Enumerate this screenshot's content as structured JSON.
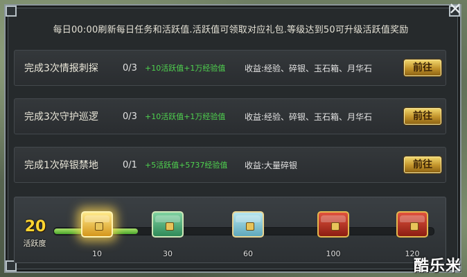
{
  "notice": "每日00:00刷新每日任务和活跃值.活跃值可领取对应礼包.等级达到50可升级活跃值奖励",
  "close_icon": "✕",
  "tasks": [
    {
      "name": "完成3次情报刺探",
      "count": "0/3",
      "reward": "+10活跃值+1万经验值",
      "gain": "收益:经验、碎银、玉石箱、月华石",
      "button": "前往"
    },
    {
      "name": "完成3次守护巡逻",
      "count": "0/3",
      "reward": "+10活跃值+1万经验值",
      "gain": "收益:经验、碎银、玉石箱、月华石",
      "button": "前往"
    },
    {
      "name": "完成1次碎银禁地",
      "count": "0/1",
      "reward": "+5活跃值+5737经验值",
      "gain": "收益:大量碎银",
      "button": "前往"
    }
  ],
  "activity": {
    "value": "20",
    "label": "活跃度",
    "fill_fraction": 0.22,
    "milestones": [
      {
        "value": "10",
        "chest": "gold-chest-icon"
      },
      {
        "value": "30",
        "chest": "green-chest-icon"
      },
      {
        "value": "60",
        "chest": "cyan-chest-icon"
      },
      {
        "value": "100",
        "chest": "red-chest-icon"
      },
      {
        "value": "120",
        "chest": "red-chest-icon"
      }
    ]
  },
  "watermark": "酷乐米",
  "colors": {
    "reward_green": "#4fd34f",
    "button_gold": "#c1922a",
    "activity_yellow": "#ffd531"
  }
}
